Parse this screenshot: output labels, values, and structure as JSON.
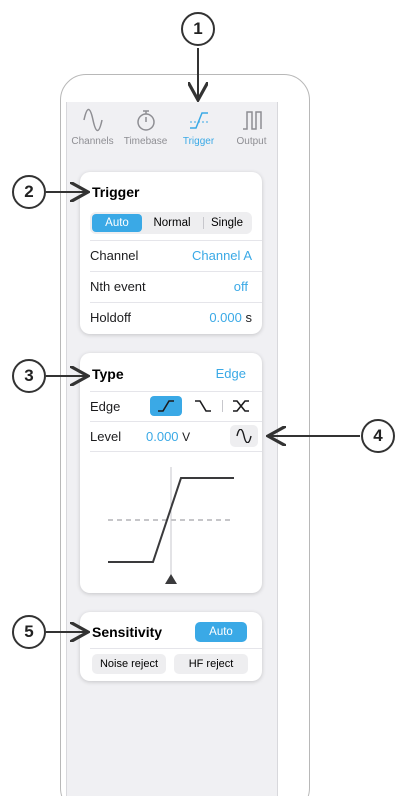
{
  "callouts": [
    "1",
    "2",
    "3",
    "4",
    "5"
  ],
  "tabs": [
    {
      "label": "Channels",
      "icon": "sine-wave-icon",
      "active": false
    },
    {
      "label": "Timebase",
      "icon": "stopwatch-icon",
      "active": false
    },
    {
      "label": "Trigger",
      "icon": "trigger-edge-icon",
      "active": true
    },
    {
      "label": "Output",
      "icon": "square-pulse-icon",
      "active": false
    }
  ],
  "trigger": {
    "title": "Trigger",
    "modes": [
      "Auto",
      "Normal",
      "Single"
    ],
    "selected_mode": "Auto",
    "channel_label": "Channel",
    "channel_value": "Channel A",
    "nth_label": "Nth event",
    "nth_value": "off",
    "holdoff_label": "Holdoff",
    "holdoff_value": "0.000",
    "holdoff_unit": "s"
  },
  "type": {
    "title": "Type",
    "value": "Edge",
    "edge_label": "Edge",
    "edge_options": [
      "rising-edge-icon",
      "falling-edge-icon",
      "either-edge-icon"
    ],
    "selected_edge": "rising-edge-icon",
    "level_label": "Level",
    "level_value": "0.000",
    "level_unit": "V",
    "level_icon": "sine-wave-icon"
  },
  "sensitivity": {
    "title": "Sensitivity",
    "auto_label": "Auto",
    "noise_reject_label": "Noise reject",
    "hf_reject_label": "HF reject"
  },
  "colors": {
    "accent": "#3aa9e6",
    "card": "#ffffff",
    "panel": "#f0f0f3",
    "text": "#1c1c1e",
    "muted": "#8e8e93"
  }
}
